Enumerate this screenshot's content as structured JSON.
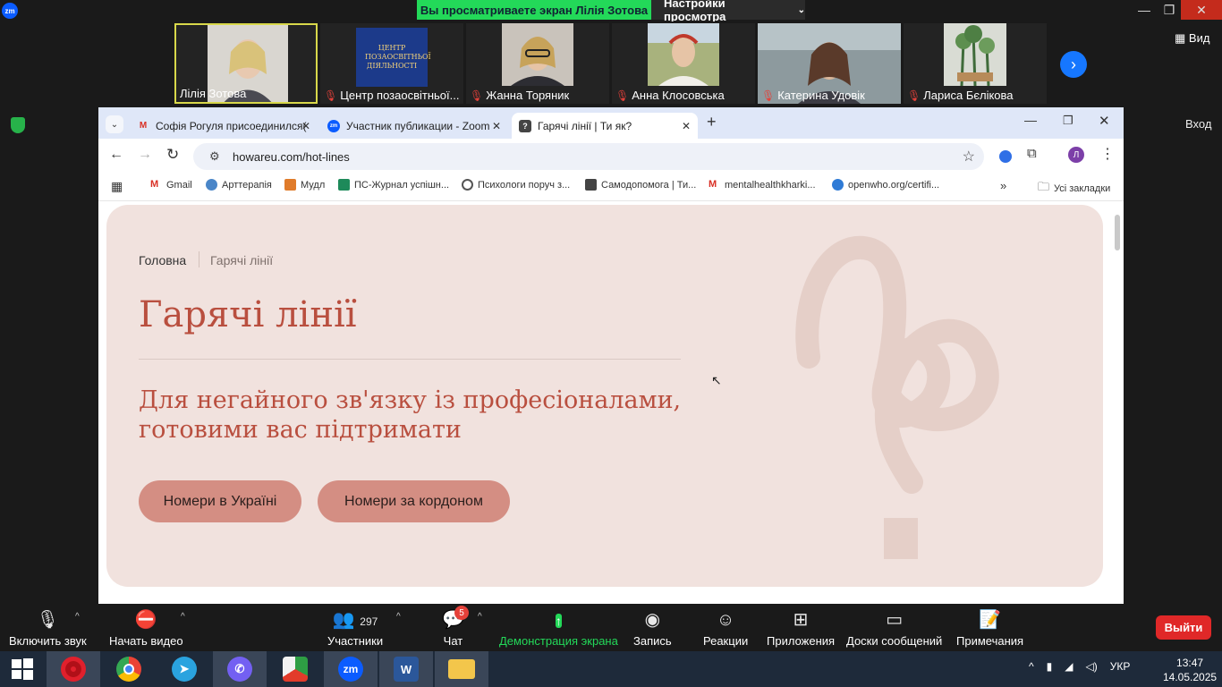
{
  "zoom": {
    "share_banner": "Вы просматриваете экран Лілія Зотова",
    "view_settings": "Настройки просмотра",
    "view_label": "Вид",
    "login_label": "Вход",
    "participants": [
      {
        "name": "Лілія Зотова",
        "muted": false
      },
      {
        "name": "Центр позаосвітньої...",
        "muted": true
      },
      {
        "name": "Жанна Торяник",
        "muted": true
      },
      {
        "name": "Анна Клосовська",
        "muted": true
      },
      {
        "name": "Катерина Удовік",
        "muted": true
      },
      {
        "name": "Лариса Бєлікова",
        "muted": true
      }
    ],
    "center_logo_text": "ЦЕНТР ПОЗАОСВІТНЬОЇ ДІЯЛЬНОСТІ",
    "controls": {
      "audio": "Включить звук",
      "video": "Начать видео",
      "participants": "Участники",
      "participants_count": "297",
      "chat": "Чат",
      "chat_badge": "5",
      "share": "Демонстрация экрана",
      "record": "Запись",
      "reactions": "Реакции",
      "apps": "Приложения",
      "whiteboards": "Доски сообщений",
      "notes": "Примечания",
      "leave": "Выйти"
    }
  },
  "browser": {
    "tabs": [
      {
        "title": "Софія Рогуля присоединился(",
        "icon": "gmail-icon"
      },
      {
        "title": "Участник публикации - Zoom",
        "icon": "zoom-icon"
      },
      {
        "title": "Гарячі лінії | Ти як?",
        "icon": "howareu-icon"
      }
    ],
    "url": "howareu.com/hot-lines",
    "profile_initial": "Л",
    "bookmarks": [
      "Gmail",
      "Арттерапія",
      "Мудл",
      "ПС-Журнал успішн...",
      "Психологи поруч з...",
      "Самодопомога | Ти...",
      "mentalhealthkharki...",
      "openwho.org/certifi..."
    ],
    "all_bookmarks": "Усі закладки"
  },
  "page": {
    "breadcrumb_home": "Головна",
    "breadcrumb_current": "Гарячі лінії",
    "title": "Гарячі лінії",
    "subtitle": "Для негайного зв'язку із професіоналами, готовими вас підтримати",
    "btn_ukraine": "Номери в Україні",
    "btn_abroad": "Номери за кордоном",
    "accent_color": "#b94f3f",
    "hero_bg": "#f1e2de"
  },
  "taskbar": {
    "lang": "УКР",
    "time": "13:47",
    "date": "14.05.2025",
    "zoom_label": "zm"
  }
}
